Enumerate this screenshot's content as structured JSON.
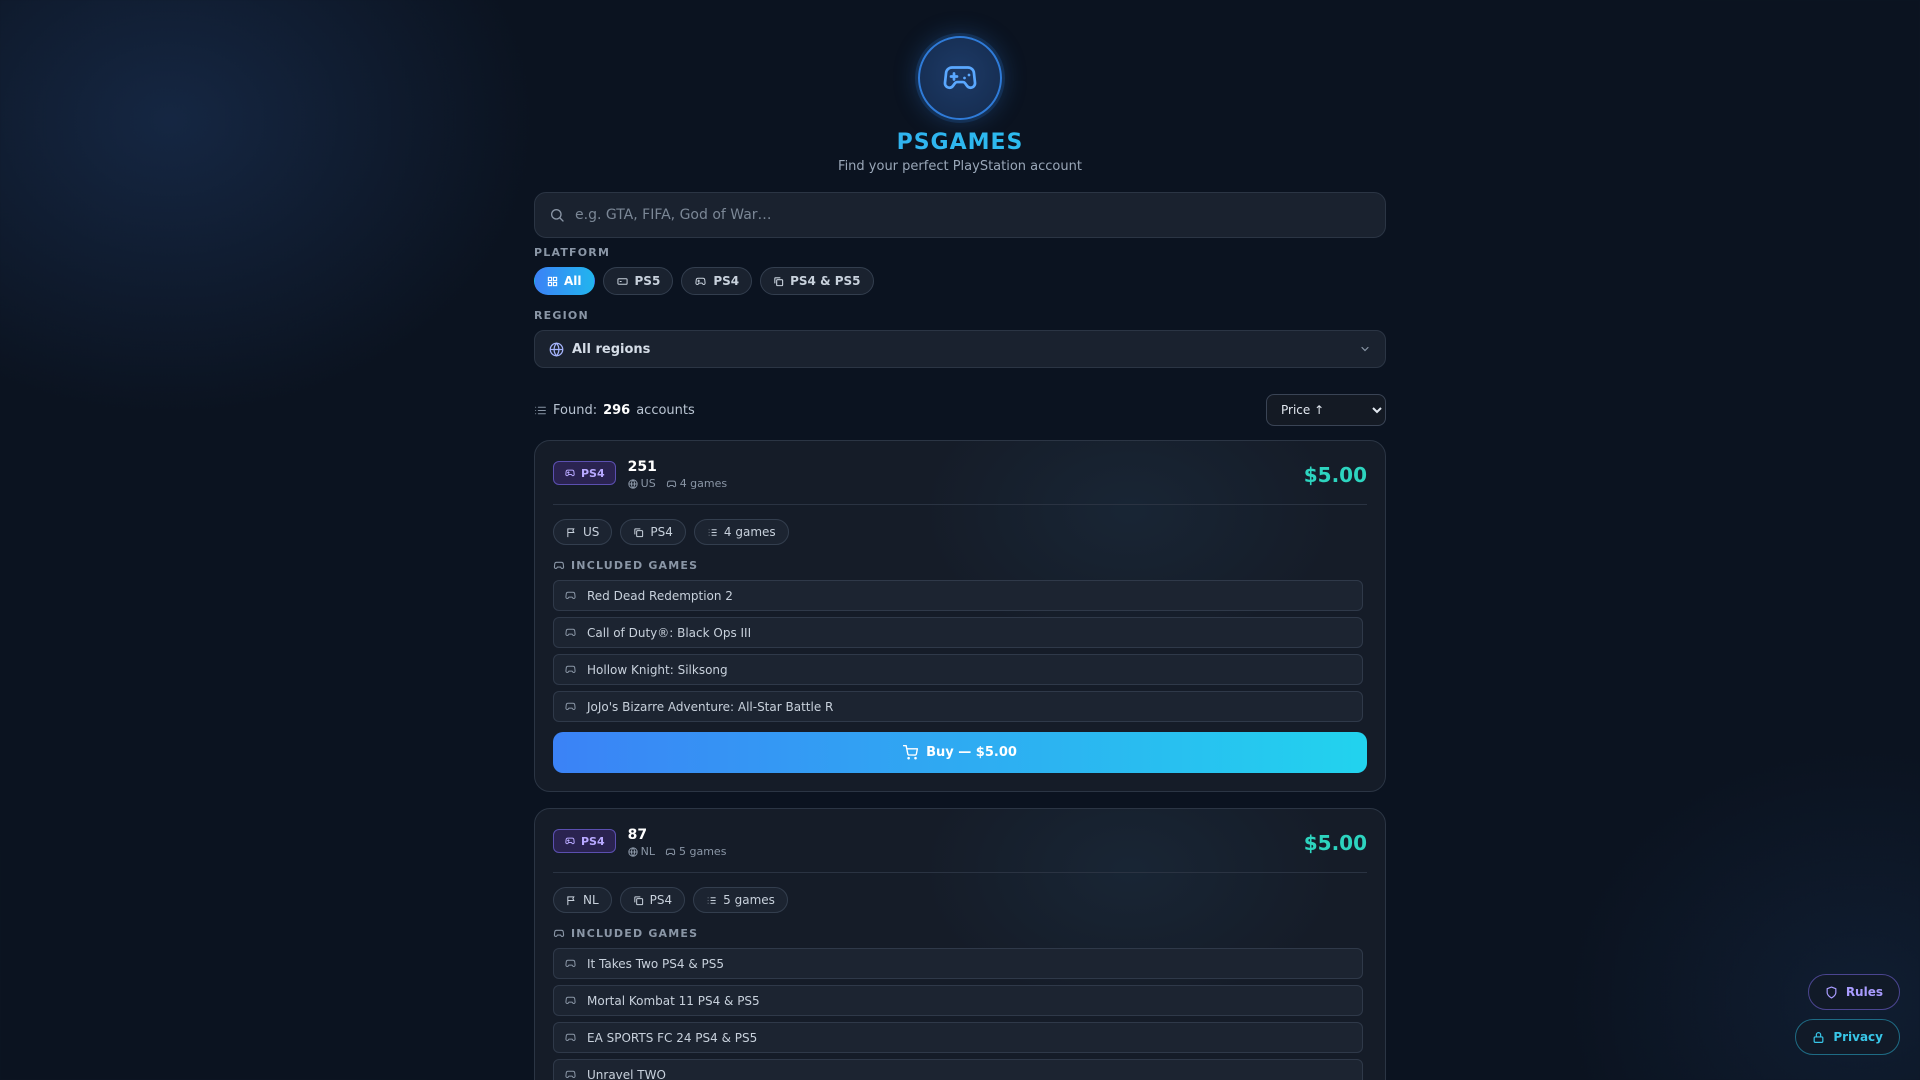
{
  "header": {
    "brand": "PSGAMES",
    "tagline": "Find your perfect PlayStation account"
  },
  "search": {
    "placeholder": "e.g. GTA, FIFA, God of War…",
    "value": ""
  },
  "filters": {
    "platform_label": "PLATFORM",
    "platforms": [
      {
        "label": "All",
        "icon": "grid-icon",
        "active": true
      },
      {
        "label": "PS5",
        "icon": "console-icon",
        "active": false
      },
      {
        "label": "PS4",
        "icon": "gamepad-icon",
        "active": false
      },
      {
        "label": "PS4 & PS5",
        "icon": "copy-icon",
        "active": false
      }
    ],
    "region_label": "REGION",
    "region_value": "All regions"
  },
  "results": {
    "found_label": "Found:",
    "count": "296",
    "suffix": "accounts",
    "sort_value": "Price ↑"
  },
  "cards": [
    {
      "platform": "PS4",
      "id": "251",
      "region": "US",
      "games_count": "4 games",
      "price": "$5.00",
      "tags": [
        "US",
        "PS4",
        "4 games"
      ],
      "included_label": "INCLUDED GAMES",
      "games": [
        "Red Dead Redemption 2",
        "Call of Duty®: Black Ops III",
        "Hollow Knight: Silksong",
        "JoJo's Bizarre Adventure: All-Star Battle R"
      ],
      "buy_label": "Buy — $5.00"
    },
    {
      "platform": "PS4",
      "id": "87",
      "region": "NL",
      "games_count": "5 games",
      "price": "$5.00",
      "tags": [
        "NL",
        "PS4",
        "5 games"
      ],
      "included_label": "INCLUDED GAMES",
      "games": [
        "It Takes Two PS4 & PS5",
        "Mortal Kombat 11 PS4 & PS5",
        "EA SPORTS FC 24 PS4 & PS5",
        "Unravel TWO"
      ]
    }
  ],
  "floating": {
    "rules": "Rules",
    "privacy": "Privacy"
  },
  "colors": {
    "accent_start": "#3b82f6",
    "accent_end": "#22d3ee",
    "price": "#2dd4bf",
    "ps4_badge": "#b8a9ff",
    "background": "#0b1320"
  }
}
